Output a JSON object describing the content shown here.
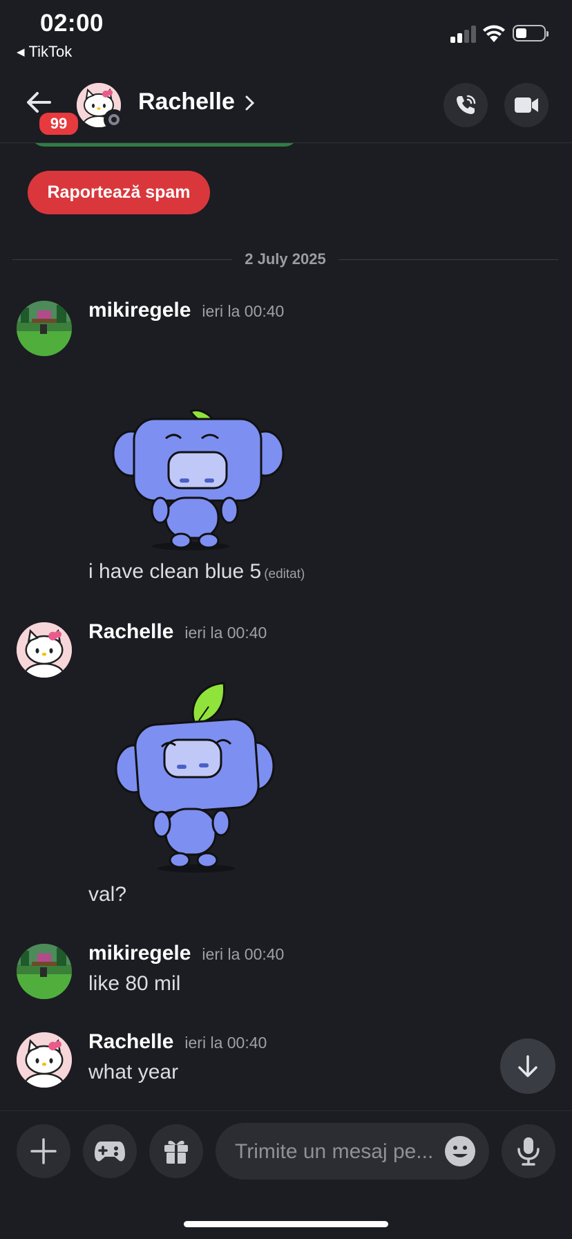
{
  "status_bar": {
    "time": "02:00",
    "back_app": "TikTok"
  },
  "header": {
    "unread_badge": "99",
    "title": "Rachelle",
    "call_icon": "phone-call-icon",
    "video_icon": "video-camera-icon"
  },
  "banner": {
    "spam_button_label": "Raportează spam"
  },
  "date_divider": "2 July 2025",
  "messages": [
    {
      "author": "mikiregele",
      "time": "ieri la 00:40",
      "sticker": "wumpus-leaf-sticker",
      "text": "i have clean blue 5",
      "edited": "(editat)"
    },
    {
      "author": "Rachelle",
      "time": "ieri la 00:40",
      "sticker": "wumpus-leaf-sticker",
      "text": "val?"
    },
    {
      "author": "mikiregele",
      "time": "ieri la 00:40",
      "text": "like 80 mil"
    },
    {
      "author": "Rachelle",
      "time": "ieri la 00:40",
      "text": "what year"
    }
  ],
  "composer": {
    "placeholder": "Trimite un mesaj pe...",
    "buttons": [
      "plus-icon",
      "gamepad-icon",
      "gift-icon",
      "emoji-icon",
      "microphone-icon"
    ]
  },
  "colors": {
    "background": "#1c1d23",
    "spam": "#da373c",
    "badge": "#e63a3f",
    "blurple": "#7d8ff0",
    "leaf": "#8fe33a"
  }
}
